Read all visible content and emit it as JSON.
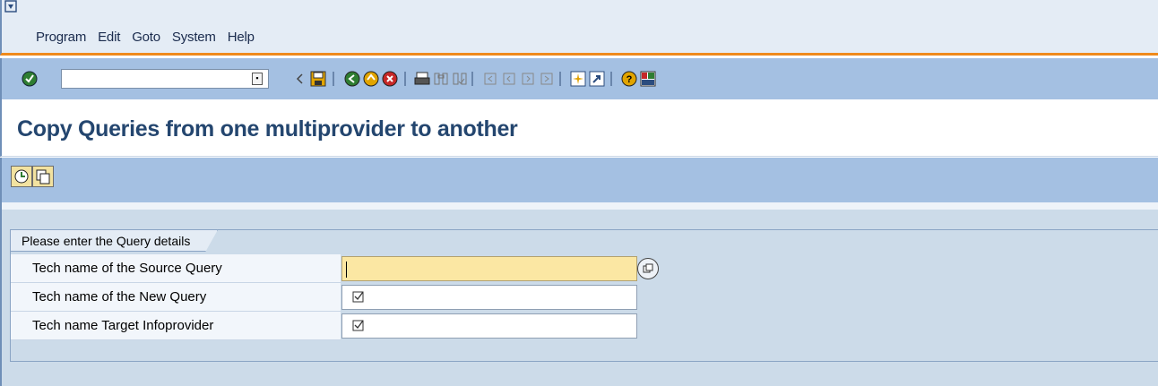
{
  "menubar": {
    "items": [
      "Program",
      "Edit",
      "Goto",
      "System",
      "Help"
    ]
  },
  "toolbar": {
    "command_field_value": "",
    "icons": [
      "enter-icon",
      "back-arrow-icon",
      "save-icon",
      "back-icon",
      "exit-icon",
      "cancel-icon",
      "print-icon",
      "find-icon",
      "find-next-icon",
      "first-page-icon",
      "previous-page-icon",
      "next-page-icon",
      "last-page-icon",
      "create-session-icon",
      "shortcut-icon",
      "help-icon",
      "customize-layout-icon"
    ]
  },
  "header": {
    "title": "Copy Queries from one multiprovider to another"
  },
  "app_toolbar": {
    "icons": [
      "execute-icon",
      "copy-icon"
    ]
  },
  "form": {
    "group_title": "Please enter the Query details",
    "fields": [
      {
        "label": "Tech name of the Source Query",
        "value": "",
        "active": true
      },
      {
        "label": "Tech name of the New Query",
        "value": "",
        "required": true
      },
      {
        "label": "Tech name Target Infoprovider",
        "value": "",
        "required": true
      }
    ]
  }
}
